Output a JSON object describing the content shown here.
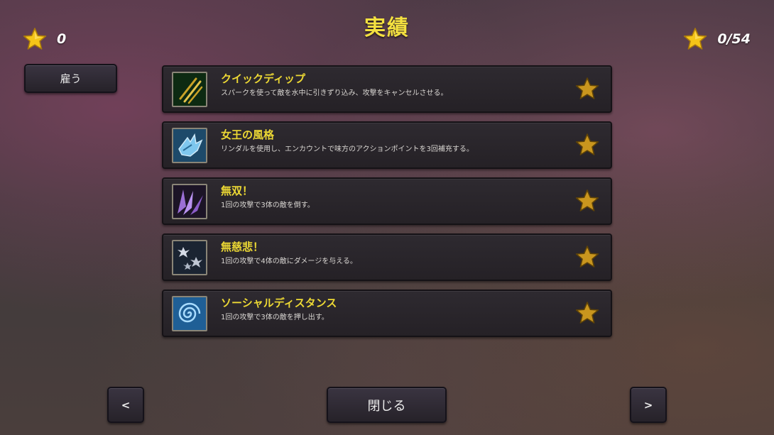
{
  "title": "実績",
  "stars_earned": "0",
  "achievements_progress": "0/54",
  "hire_button": "雇う",
  "achievements": [
    {
      "name": "クイックディップ",
      "description": "スパークを使って敵を水中に引きずり込み、攻撃をキャンセルさせる。",
      "icon": "claw-slash-icon",
      "completed": false
    },
    {
      "name": "女王の風格",
      "description": "リンダルを使用し、エンカウントで味方のアクションポイントを3回補充する。",
      "icon": "blue-gauntlet-icon",
      "completed": false
    },
    {
      "name": "無双！",
      "description": "1回の攻撃で3体の敵を倒す。",
      "icon": "purple-spikes-icon",
      "completed": false
    },
    {
      "name": "無慈悲！",
      "description": "1回の攻撃で4体の敵にダメージを与える。",
      "icon": "shuriken-icon",
      "completed": false
    },
    {
      "name": "ソーシャルディスタンス",
      "description": "1回の攻撃で3体の敵を押し出す。",
      "icon": "blue-vortex-icon",
      "completed": false
    }
  ],
  "prev_button": "<",
  "next_button": ">",
  "close_button": "閉じる",
  "colors": {
    "title": "#f3e040",
    "achievement_name": "#ecd834",
    "star": "#f5c518",
    "star_incomplete": "#b08a22"
  }
}
